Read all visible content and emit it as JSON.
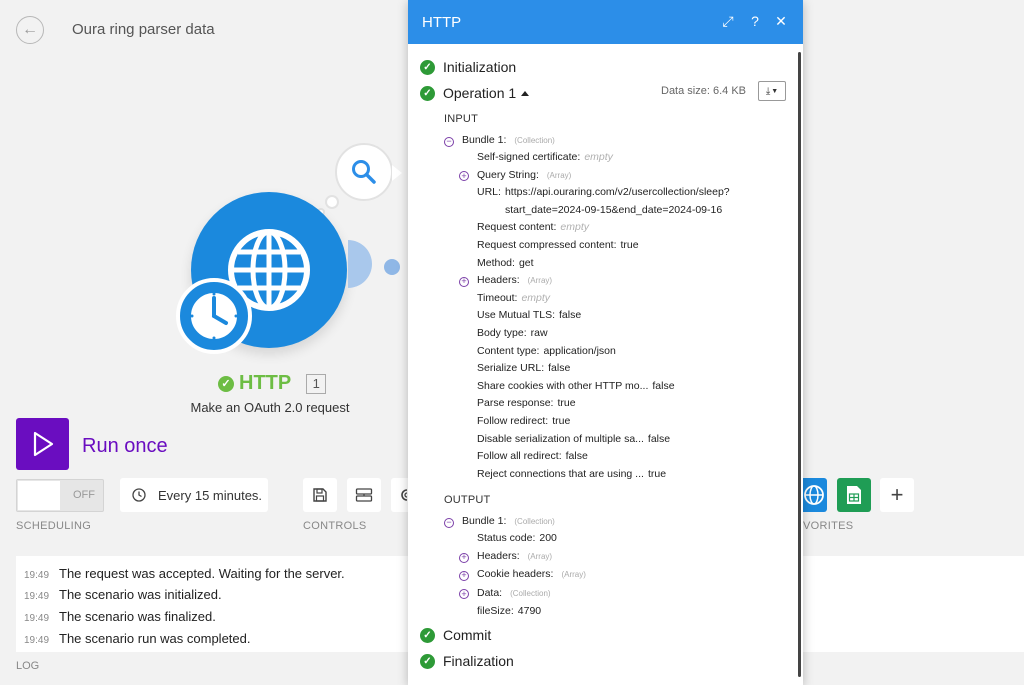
{
  "app": {
    "title": "Oura ring parser data"
  },
  "module": {
    "name": "HTTP",
    "badge": "1",
    "description": "Make an OAuth 2.0 request"
  },
  "run": {
    "label": "Run once"
  },
  "scheduling": {
    "toggle_state": "OFF",
    "schedule_text": "Every 15 minutes.",
    "section_label": "SCHEDULING"
  },
  "controls": {
    "section_label": "CONTROLS"
  },
  "favorites": {
    "section_label": "VORITES"
  },
  "log": {
    "label": "LOG",
    "rows": [
      {
        "time": "19:49",
        "text": "The request was accepted. Waiting for the server."
      },
      {
        "time": "19:49",
        "text": "The scenario was initialized."
      },
      {
        "time": "19:49",
        "text": "The scenario was finalized."
      },
      {
        "time": "19:49",
        "text": "The scenario run was completed."
      }
    ]
  },
  "panel": {
    "title": "HTTP",
    "steps": {
      "initialization": "Initialization",
      "operation": "Operation 1",
      "commit": "Commit",
      "finalization": "Finalization"
    },
    "data_size": "Data size: 6.4 KB",
    "input_label": "INPUT",
    "output_label": "OUTPUT",
    "input_bundle": {
      "key": "Bundle 1:",
      "type": "(Collection)"
    },
    "input_rows": [
      {
        "key": "Self-signed certificate:",
        "value": "empty",
        "empty": true,
        "expand": ""
      },
      {
        "key": "Query String:",
        "value": "",
        "type": "(Array)",
        "expand": "+"
      },
      {
        "key": "URL:",
        "value": "https://api.ouraring.com/v2/usercollection/sleep?",
        "value2": "start_date=2024-09-15&end_date=2024-09-16",
        "expand": ""
      },
      {
        "key": "Request content:",
        "value": "empty",
        "empty": true,
        "expand": ""
      },
      {
        "key": "Request compressed content:",
        "value": "true",
        "expand": ""
      },
      {
        "key": "Method:",
        "value": "get",
        "expand": ""
      },
      {
        "key": "Headers:",
        "value": "",
        "type": "(Array)",
        "expand": "+"
      },
      {
        "key": "Timeout:",
        "value": "empty",
        "empty": true,
        "expand": ""
      },
      {
        "key": "Use Mutual TLS:",
        "value": "false",
        "expand": ""
      },
      {
        "key": "Body type:",
        "value": "raw",
        "expand": ""
      },
      {
        "key": "Content type:",
        "value": "application/json",
        "expand": ""
      },
      {
        "key": "Serialize URL:",
        "value": "false",
        "expand": ""
      },
      {
        "key": "Share cookies with other HTTP mo...",
        "value": "false",
        "expand": ""
      },
      {
        "key": "Parse response:",
        "value": "true",
        "expand": ""
      },
      {
        "key": "Follow redirect:",
        "value": "true",
        "expand": ""
      },
      {
        "key": "Disable serialization of multiple sa...",
        "value": "false",
        "expand": ""
      },
      {
        "key": "Follow all redirect:",
        "value": "false",
        "expand": ""
      },
      {
        "key": "Reject connections that are using ...",
        "value": "true",
        "expand": ""
      }
    ],
    "output_bundle": {
      "key": "Bundle 1:",
      "type": "(Collection)"
    },
    "output_rows": [
      {
        "key": "Status code:",
        "value": "200",
        "expand": ""
      },
      {
        "key": "Headers:",
        "value": "",
        "type": "(Array)",
        "expand": "+"
      },
      {
        "key": "Cookie headers:",
        "value": "",
        "type": "(Array)",
        "expand": "+"
      },
      {
        "key": "Data:",
        "value": "",
        "type": "(Collection)",
        "expand": "+"
      },
      {
        "key": "fileSize:",
        "value": "4790",
        "expand": ""
      }
    ]
  },
  "icons": {
    "back": "arrow-left-icon",
    "search": "search-icon",
    "globe": "globe-icon",
    "clock": "clock-icon",
    "play": "play-icon",
    "save": "save-icon",
    "flow": "flow-control-icon",
    "gear": "gear-icon",
    "sheets": "google-sheets-icon",
    "plus": "plus-icon",
    "expand": "expand-icon",
    "help": "help-icon",
    "close": "close-icon",
    "download": "download-icon"
  },
  "colors": {
    "accent": "#2c8ee8",
    "run": "#6a0dc0",
    "success": "#2e9a37",
    "module_green": "#6dbd44",
    "http_blue": "#1b89dd"
  }
}
